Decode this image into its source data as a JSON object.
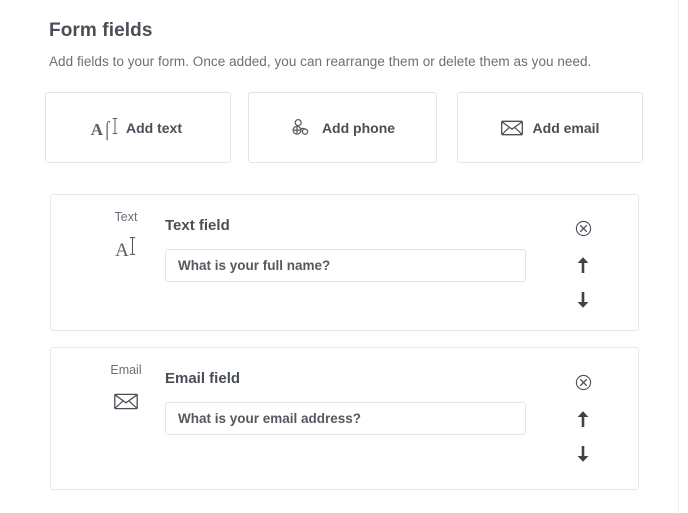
{
  "header": {
    "title": "Form fields",
    "subtitle": "Add fields to your form. Once added, you can rearrange them or delete them as you need."
  },
  "add_buttons": [
    {
      "label": "Add text",
      "icon": "text-cursor-icon"
    },
    {
      "label": "Add phone",
      "icon": "phone-handset-icon"
    },
    {
      "label": "Add email",
      "icon": "envelope-icon"
    }
  ],
  "fields": [
    {
      "type_label": "Text",
      "type_icon": "text-cursor-icon",
      "title": "Text field",
      "input_value": "What is your full name?",
      "input_placeholder": "What is your full name?",
      "actions": {
        "remove": "remove-field",
        "move_up": "move-field-up",
        "move_down": "move-field-down"
      }
    },
    {
      "type_label": "Email",
      "type_icon": "envelope-icon",
      "title": "Email field",
      "input_value": "What is your email address?",
      "input_placeholder": "What is your email address?",
      "actions": {
        "remove": "remove-field",
        "move_up": "move-field-up",
        "move_down": "move-field-down"
      }
    }
  ],
  "colors": {
    "text_primary": "#4a4f57",
    "text_secondary": "#6a6f78",
    "border": "#e4e5e7",
    "background": "#ffffff"
  }
}
